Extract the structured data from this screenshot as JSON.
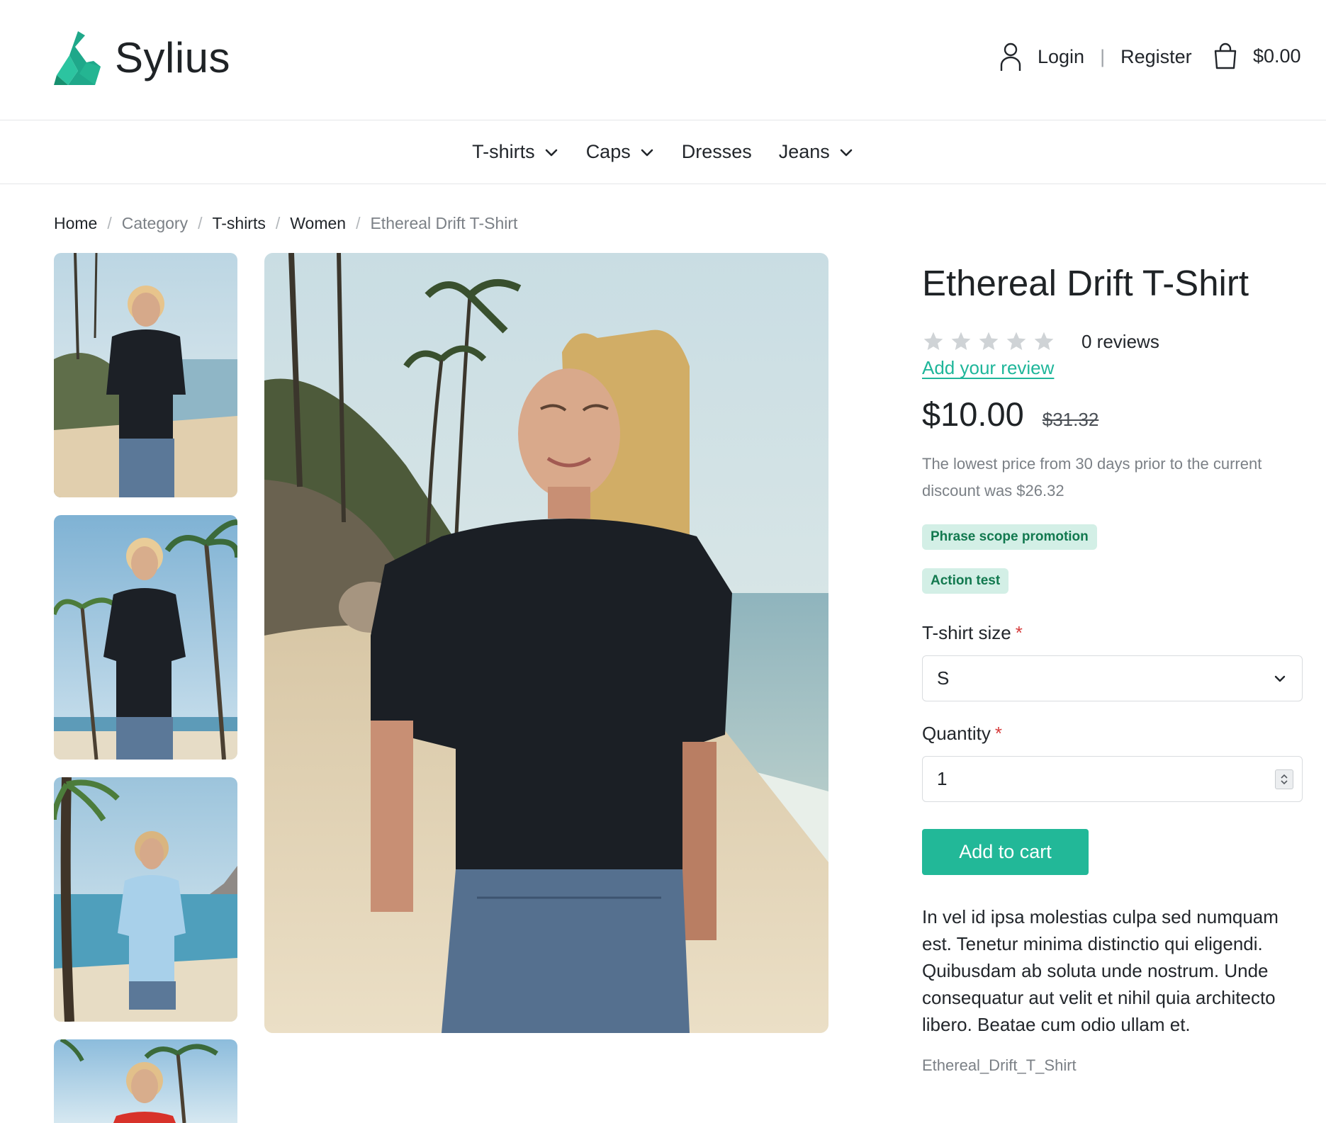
{
  "header": {
    "brand": "Sylius",
    "login_label": "Login",
    "separator": "|",
    "register_label": "Register",
    "cart_total": "$0.00"
  },
  "nav": {
    "items": [
      {
        "label": "T-shirts",
        "has_dropdown": true
      },
      {
        "label": "Caps",
        "has_dropdown": true
      },
      {
        "label": "Dresses",
        "has_dropdown": false
      },
      {
        "label": "Jeans",
        "has_dropdown": true
      }
    ]
  },
  "breadcrumb": {
    "items": [
      "Home",
      "Category",
      "T-shirts",
      "Women",
      "Ethereal Drift T-Shirt"
    ],
    "separator": "/"
  },
  "gallery": {
    "thumbnails": [
      {
        "alt": "black-tshirt-beach-front"
      },
      {
        "alt": "black-tshirt-palms"
      },
      {
        "alt": "light-blue-tshirt-beach"
      },
      {
        "alt": "red-tshirt-palms"
      }
    ],
    "main": {
      "alt": "black-tshirt-beach-main"
    }
  },
  "product": {
    "title": "Ethereal Drift T-Shirt",
    "rating_stars": 0,
    "reviews_label": "0 reviews",
    "add_review_label": "Add your review",
    "price": "$10.00",
    "original_price": "$31.32",
    "lowest_price_note": "The lowest price from 30 days prior to the current discount was $26.32",
    "promotions": [
      "Phrase scope promotion",
      "Action test"
    ],
    "size_label": "T-shirt size",
    "size_value": "S",
    "quantity_label": "Quantity",
    "quantity_value": "1",
    "required_mark": "*",
    "add_to_cart_label": "Add to cart",
    "description": "In vel id ipsa molestias culpa sed numquam est. Tenetur minima distinctio qui eligendi. Quibusdam ab soluta unde nostrum. Unde consequatur aut velit et nihil quia architecto libero. Beatae cum odio ullam et.",
    "code": "Ethereal_Drift_T_Shirt"
  },
  "colors": {
    "accent": "#22b898",
    "link": "#1fb69a",
    "badge_bg": "#d3efe6",
    "badge_text": "#12794f",
    "required": "#d63d3d",
    "muted_text": "#7b8086"
  }
}
